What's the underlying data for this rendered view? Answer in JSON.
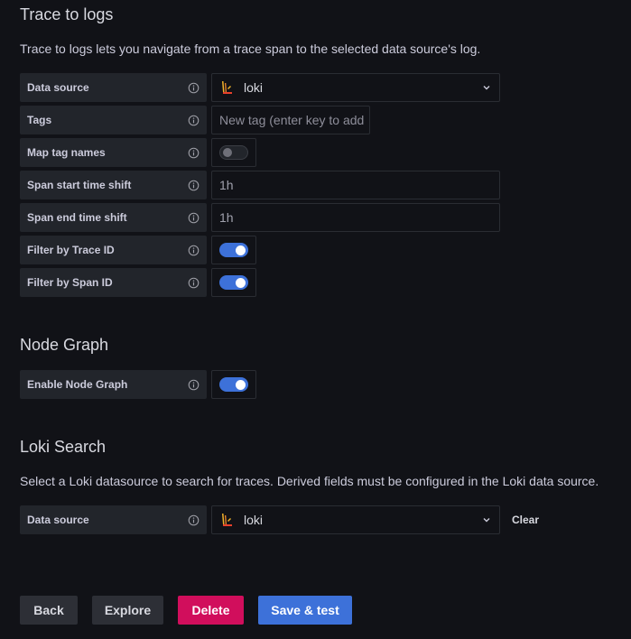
{
  "trace_to_logs": {
    "title": "Trace to logs",
    "description": "Trace to logs lets you navigate from a trace span to the selected data source's log.",
    "data_source": {
      "label": "Data source",
      "value": "loki"
    },
    "tags": {
      "label": "Tags",
      "placeholder": "New tag (enter key to add"
    },
    "map_tag_names": {
      "label": "Map tag names",
      "enabled": false
    },
    "span_start_time_shift": {
      "label": "Span start time shift",
      "placeholder": "1h"
    },
    "span_end_time_shift": {
      "label": "Span end time shift",
      "placeholder": "1h"
    },
    "filter_by_trace_id": {
      "label": "Filter by Trace ID",
      "enabled": true
    },
    "filter_by_span_id": {
      "label": "Filter by Span ID",
      "enabled": true
    }
  },
  "node_graph": {
    "title": "Node Graph",
    "enable_node_graph": {
      "label": "Enable Node Graph",
      "enabled": true
    }
  },
  "loki_search": {
    "title": "Loki Search",
    "description": "Select a Loki datasource to search for traces. Derived fields must be configured in the Loki data source.",
    "data_source": {
      "label": "Data source",
      "value": "loki"
    },
    "clear_label": "Clear"
  },
  "actions": {
    "back": "Back",
    "explore": "Explore",
    "delete": "Delete",
    "save_test": "Save & test"
  },
  "colors": {
    "background": "#111217",
    "label_bg": "#22252b",
    "primary": "#3d71d9",
    "danger": "#d10e5c"
  },
  "icons": {
    "info": "info-circle-icon",
    "chevron": "chevron-down-icon",
    "loki": "loki-logo-icon"
  }
}
